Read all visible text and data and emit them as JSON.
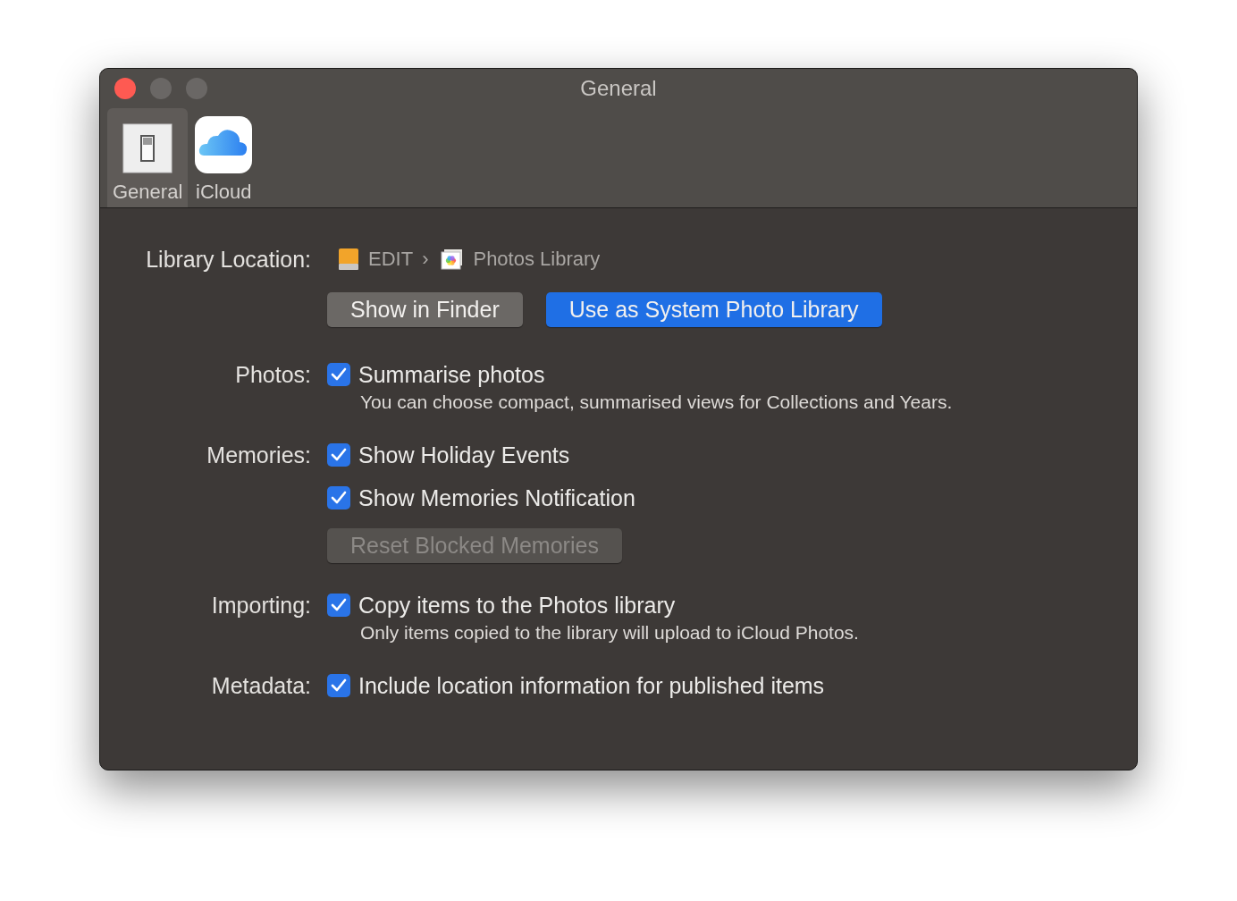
{
  "window": {
    "title": "General"
  },
  "toolbar": {
    "tabs": [
      {
        "label": "General",
        "kind": "general",
        "selected": true
      },
      {
        "label": "iCloud",
        "kind": "icloud",
        "selected": false
      }
    ]
  },
  "library_location": {
    "label": "Library Location:",
    "path": [
      {
        "kind": "drive",
        "text": "EDIT"
      },
      {
        "kind": "separator",
        "text": "›"
      },
      {
        "kind": "library",
        "text": "Photos Library"
      }
    ],
    "buttons": [
      {
        "label": "Show in Finder",
        "kind": "default"
      },
      {
        "label": "Use as System Photo Library",
        "kind": "primary"
      }
    ]
  },
  "sections": [
    {
      "label": "Photos:",
      "items": [
        {
          "kind": "checkbox",
          "label": "Summarise photos",
          "checked": true,
          "description": "You can choose compact, summarised views for Collections and Years."
        }
      ]
    },
    {
      "label": "Memories:",
      "items": [
        {
          "kind": "checkbox",
          "label": "Show Holiday Events",
          "checked": true
        },
        {
          "kind": "checkbox",
          "label": "Show Memories Notification",
          "checked": true
        },
        {
          "kind": "button",
          "label": "Reset Blocked Memories",
          "disabled": true
        }
      ]
    },
    {
      "label": "Importing:",
      "items": [
        {
          "kind": "checkbox",
          "label": "Copy items to the Photos library",
          "checked": true,
          "description": "Only items copied to the library will upload to iCloud Photos."
        }
      ]
    },
    {
      "label": "Metadata:",
      "items": [
        {
          "kind": "checkbox",
          "label": "Include location information for published items",
          "checked": true
        }
      ]
    }
  ]
}
